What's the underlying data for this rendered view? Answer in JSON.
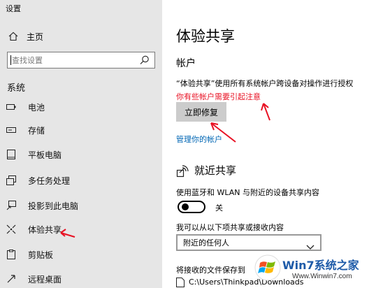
{
  "window": {
    "title": "设置"
  },
  "sidebar": {
    "home_label": "主页",
    "search_placeholder": "查找设置",
    "section_label": "系统",
    "items": [
      {
        "label": "电池",
        "icon": "battery-icon"
      },
      {
        "label": "存储",
        "icon": "storage-icon"
      },
      {
        "label": "平板电脑",
        "icon": "tablet-icon"
      },
      {
        "label": "多任务处理",
        "icon": "multitasking-icon"
      },
      {
        "label": "投影到此电脑",
        "icon": "projecting-icon"
      },
      {
        "label": "体验共享",
        "icon": "shared-experiences-icon",
        "active": true
      },
      {
        "label": "剪贴板",
        "icon": "clipboard-icon"
      },
      {
        "label": "远程桌面",
        "icon": "remote-desktop-icon"
      }
    ]
  },
  "main": {
    "title": "体验共享",
    "accounts_heading": "帐户",
    "accounts_desc": "“体验共享”使用所有系统帐户跨设备对操作进行授权",
    "warning": "你有些帐户需要引起注意",
    "fix_button": "立即修复",
    "manage_link": "管理你的帐户",
    "nearby_heading": "就近共享",
    "nearby_desc": "使用蓝牙和 WLAN 与附近的设备共享内容",
    "toggle_state": "关",
    "receive_label": "我可以从以下项共享或接收内容",
    "receive_value": "附近的任何人",
    "save_label": "将接收的文件保存到",
    "save_path": "C:\\Users\\Thinkpad\\Downloads"
  },
  "watermark": {
    "text": "Win7系统之家",
    "url": "Www.Winwin7.com"
  },
  "colors": {
    "sidebar_bg": "#e6e6e6",
    "warning": "#e81123",
    "link": "#0066b4",
    "arrow": "#e81123"
  }
}
